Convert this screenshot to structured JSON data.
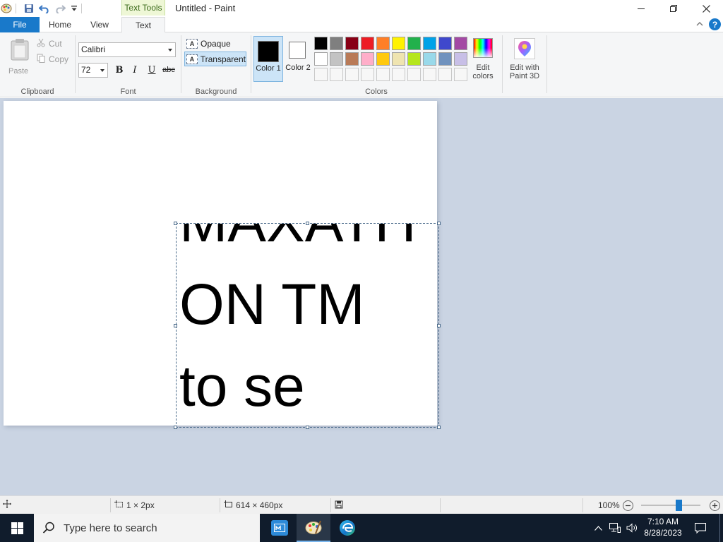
{
  "title_bar": {
    "context_tab": "Text Tools",
    "window_title": "Untitled - Paint"
  },
  "tabs": {
    "file": "File",
    "home": "Home",
    "view": "View",
    "text": "Text"
  },
  "ribbon": {
    "clipboard": {
      "paste": "Paste",
      "cut": "Cut",
      "copy": "Copy",
      "label": "Clipboard"
    },
    "font": {
      "family": "Calibri",
      "size": "72",
      "bold": "B",
      "italic": "I",
      "underline": "U",
      "strikethrough": "abc",
      "label": "Font"
    },
    "background": {
      "opaque": "Opaque",
      "transparent": "Transparent",
      "label": "Background"
    },
    "colors": {
      "color1": "Color 1",
      "color2": "Color 2",
      "edit_colors": "Edit colors",
      "label": "Colors",
      "color1_value": "#000000",
      "color2_value": "#ffffff",
      "palette_row1": [
        "#000000",
        "#7f7f7f",
        "#880015",
        "#ed1c24",
        "#ff7f27",
        "#fff200",
        "#22b14c",
        "#00a2e8",
        "#3f48cc",
        "#a349a4"
      ],
      "palette_row2": [
        "#ffffff",
        "#c3c3c3",
        "#b97a57",
        "#ffaec9",
        "#ffc90e",
        "#efe4b0",
        "#b5e61d",
        "#99d9ea",
        "#7092be",
        "#c8bfe7"
      ]
    },
    "paint3d": {
      "label": "Edit with Paint 3D"
    }
  },
  "canvas": {
    "text_lines": [
      "MAXATH",
      "ON TM",
      "to se"
    ]
  },
  "status_bar": {
    "selection_size": "1 × 2px",
    "canvas_size": "614 × 460px",
    "zoom": "100%",
    "zoom_level": 0.65
  },
  "taskbar": {
    "search_placeholder": "Type here to search",
    "time": "7:10 AM",
    "date": "8/28/2023"
  }
}
